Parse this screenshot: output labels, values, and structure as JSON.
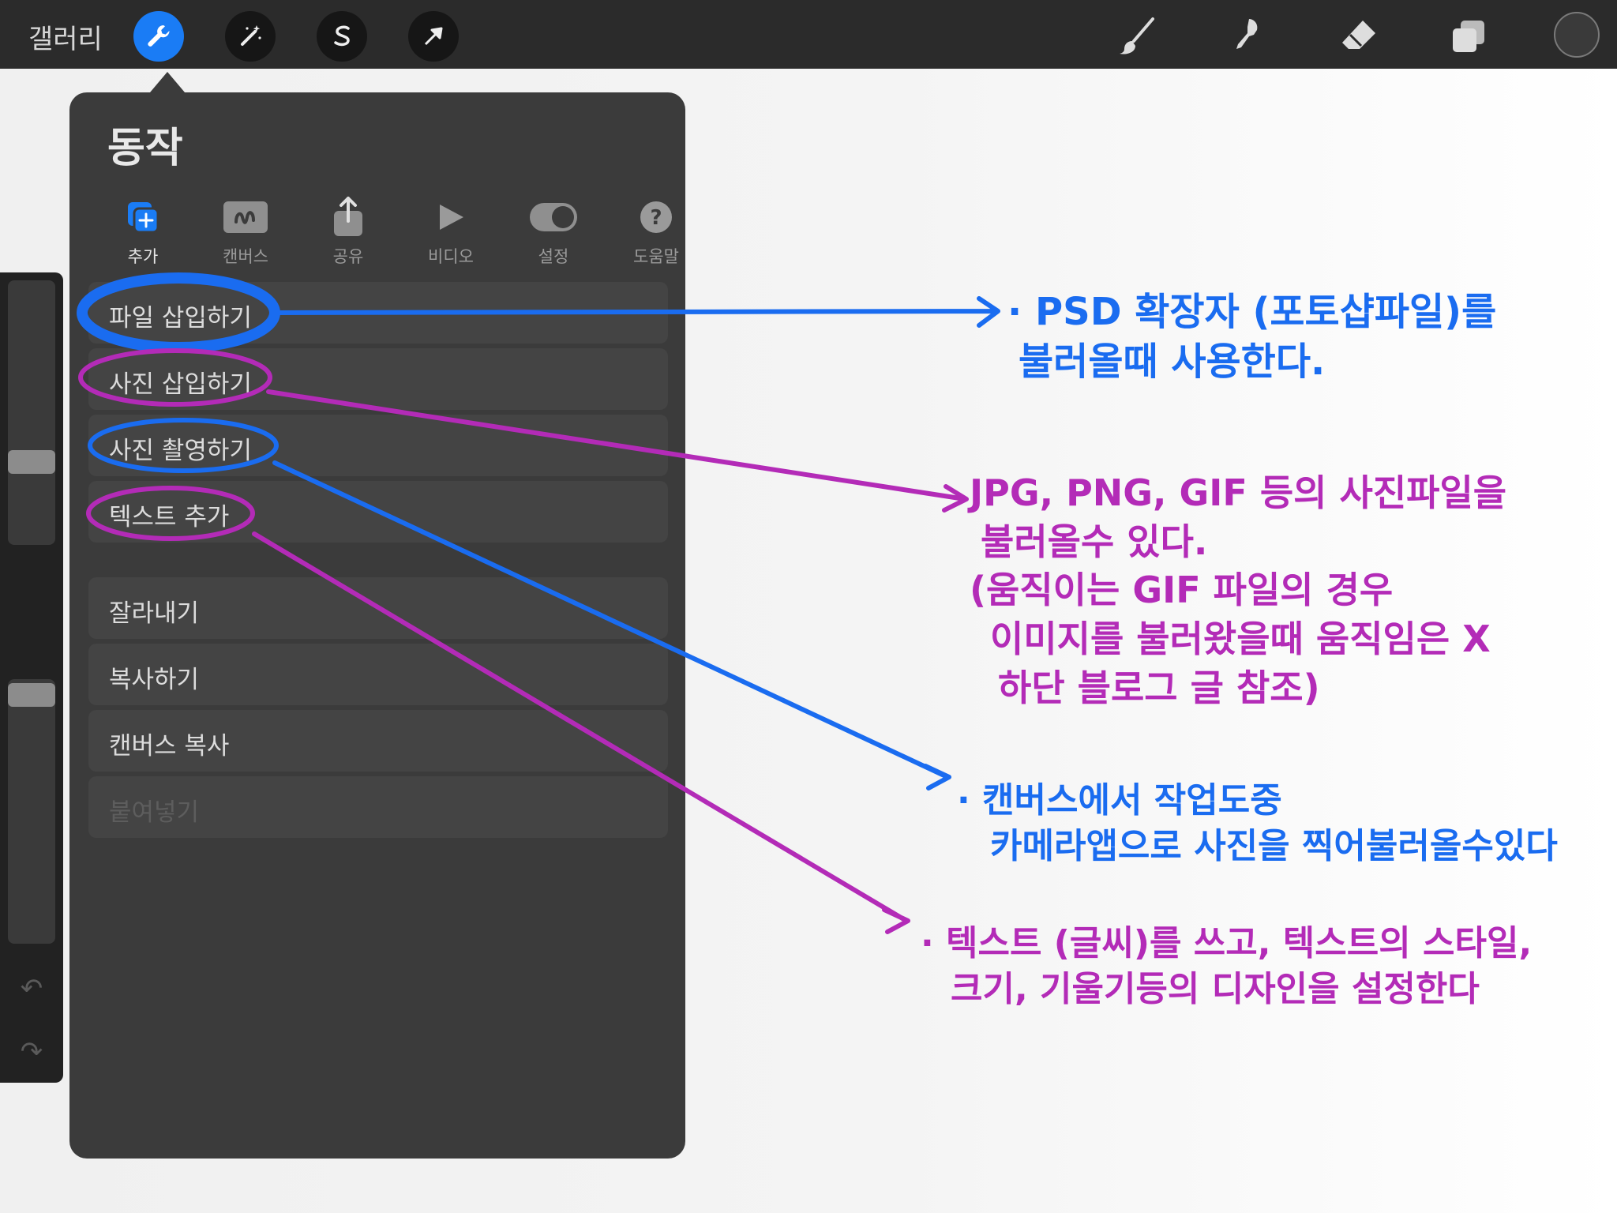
{
  "topbar": {
    "gallery_label": "갤러리",
    "left_tools": [
      "wrench-icon",
      "magic-wand-icon",
      "selection-s-icon",
      "transform-arrow-icon"
    ],
    "right_tools": [
      "brush-icon",
      "smudge-icon",
      "eraser-icon",
      "layers-icon",
      "color-circle"
    ]
  },
  "panel": {
    "title": "동작",
    "tabs": [
      {
        "label": "추가",
        "icon": "add-layers-icon",
        "selected": true
      },
      {
        "label": "캔버스",
        "icon": "canvas-wave-icon",
        "selected": false
      },
      {
        "label": "공유",
        "icon": "share-icon",
        "selected": false
      },
      {
        "label": "비디오",
        "icon": "play-icon",
        "selected": false
      },
      {
        "label": "설정",
        "icon": "toggle-icon",
        "selected": false
      },
      {
        "label": "도움말",
        "icon": "help-icon",
        "selected": false
      }
    ],
    "items": [
      {
        "label": "파일 삽입하기"
      },
      {
        "label": "사진 삽입하기"
      },
      {
        "label": "사진 촬영하기"
      },
      {
        "label": "텍스트 추가"
      },
      {
        "label": "잘라내기"
      },
      {
        "label": "복사하기"
      },
      {
        "label": "캔버스 복사"
      },
      {
        "label": "붙여넣기",
        "disabled": true
      }
    ]
  },
  "annotations": {
    "colors": {
      "blue": "#1a6cf0",
      "magenta": "#b32bb7"
    },
    "psd": [
      "· PSD 확장자 (포토샵파일)를",
      "불러올때 사용한다."
    ],
    "jpg": [
      "JPG, PNG, GIF 등의 사진파일을",
      "불러올수 있다.",
      "(움직이는 GIF 파일의 경우",
      "이미지를 불러왔을때 움직임은 X",
      "하단 블로그 글 참조)"
    ],
    "camera": [
      "· 캔버스에서 작업도중",
      "카메라앱으로 사진을 찍어불러올수있다"
    ],
    "text": [
      "· 텍스트 (글씨)를  쓰고, 텍스트의 스타일,",
      "크기, 기울기등의  디자인을 설정한다"
    ]
  }
}
